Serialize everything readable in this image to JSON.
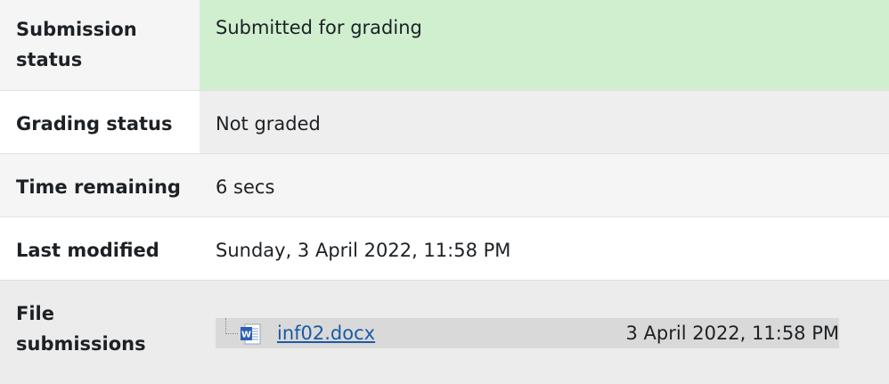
{
  "submission_status": {
    "label": "Submission status",
    "value": "Submitted for grading",
    "color": "#cfefcf"
  },
  "grading_status": {
    "label": "Grading status",
    "value": "Not graded"
  },
  "time_remaining": {
    "label": "Time remaining",
    "value": "6 secs"
  },
  "last_modified": {
    "label": "Last modified",
    "value": "Sunday, 3 April 2022, 11:58 PM"
  },
  "file_submissions": {
    "label": "File submissions",
    "files": [
      {
        "name": "inf02.docx",
        "date": "3 April 2022, 11:58 PM",
        "icon": "word-document-icon"
      }
    ]
  }
}
